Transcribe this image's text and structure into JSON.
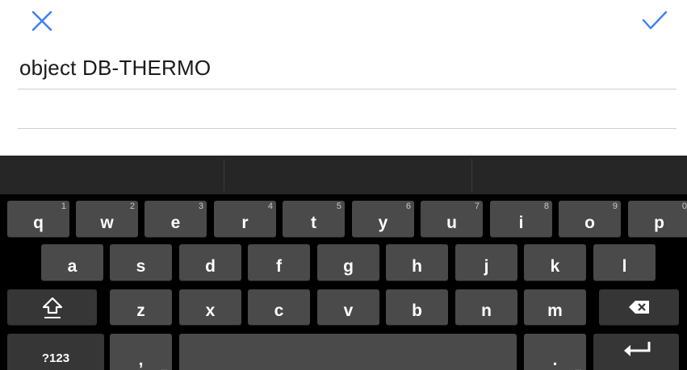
{
  "header": {
    "close_icon": "close-icon",
    "confirm_icon": "check-icon",
    "accent": "#3f7ff5"
  },
  "form": {
    "field1_value": "object DB-THERMO",
    "field2_value": ""
  },
  "keyboard": {
    "row1": [
      {
        "label": "q",
        "hint": "1"
      },
      {
        "label": "w",
        "hint": "2"
      },
      {
        "label": "e",
        "hint": "3"
      },
      {
        "label": "r",
        "hint": "4"
      },
      {
        "label": "t",
        "hint": "5"
      },
      {
        "label": "y",
        "hint": "6"
      },
      {
        "label": "u",
        "hint": "7"
      },
      {
        "label": "i",
        "hint": "8"
      },
      {
        "label": "o",
        "hint": "9"
      },
      {
        "label": "p",
        "hint": "0"
      }
    ],
    "row2": [
      {
        "label": "a"
      },
      {
        "label": "s"
      },
      {
        "label": "d"
      },
      {
        "label": "f"
      },
      {
        "label": "g"
      },
      {
        "label": "h"
      },
      {
        "label": "j"
      },
      {
        "label": "k"
      },
      {
        "label": "l"
      }
    ],
    "row3": [
      {
        "label": "z"
      },
      {
        "label": "x"
      },
      {
        "label": "c"
      },
      {
        "label": "v"
      },
      {
        "label": "b"
      },
      {
        "label": "n"
      },
      {
        "label": "m"
      }
    ],
    "symbols_label": "?123",
    "comma_label": ",",
    "period_label": ".",
    "shift_icon": "shift-icon",
    "backspace_icon": "backspace-icon",
    "enter_icon": "enter-icon"
  }
}
